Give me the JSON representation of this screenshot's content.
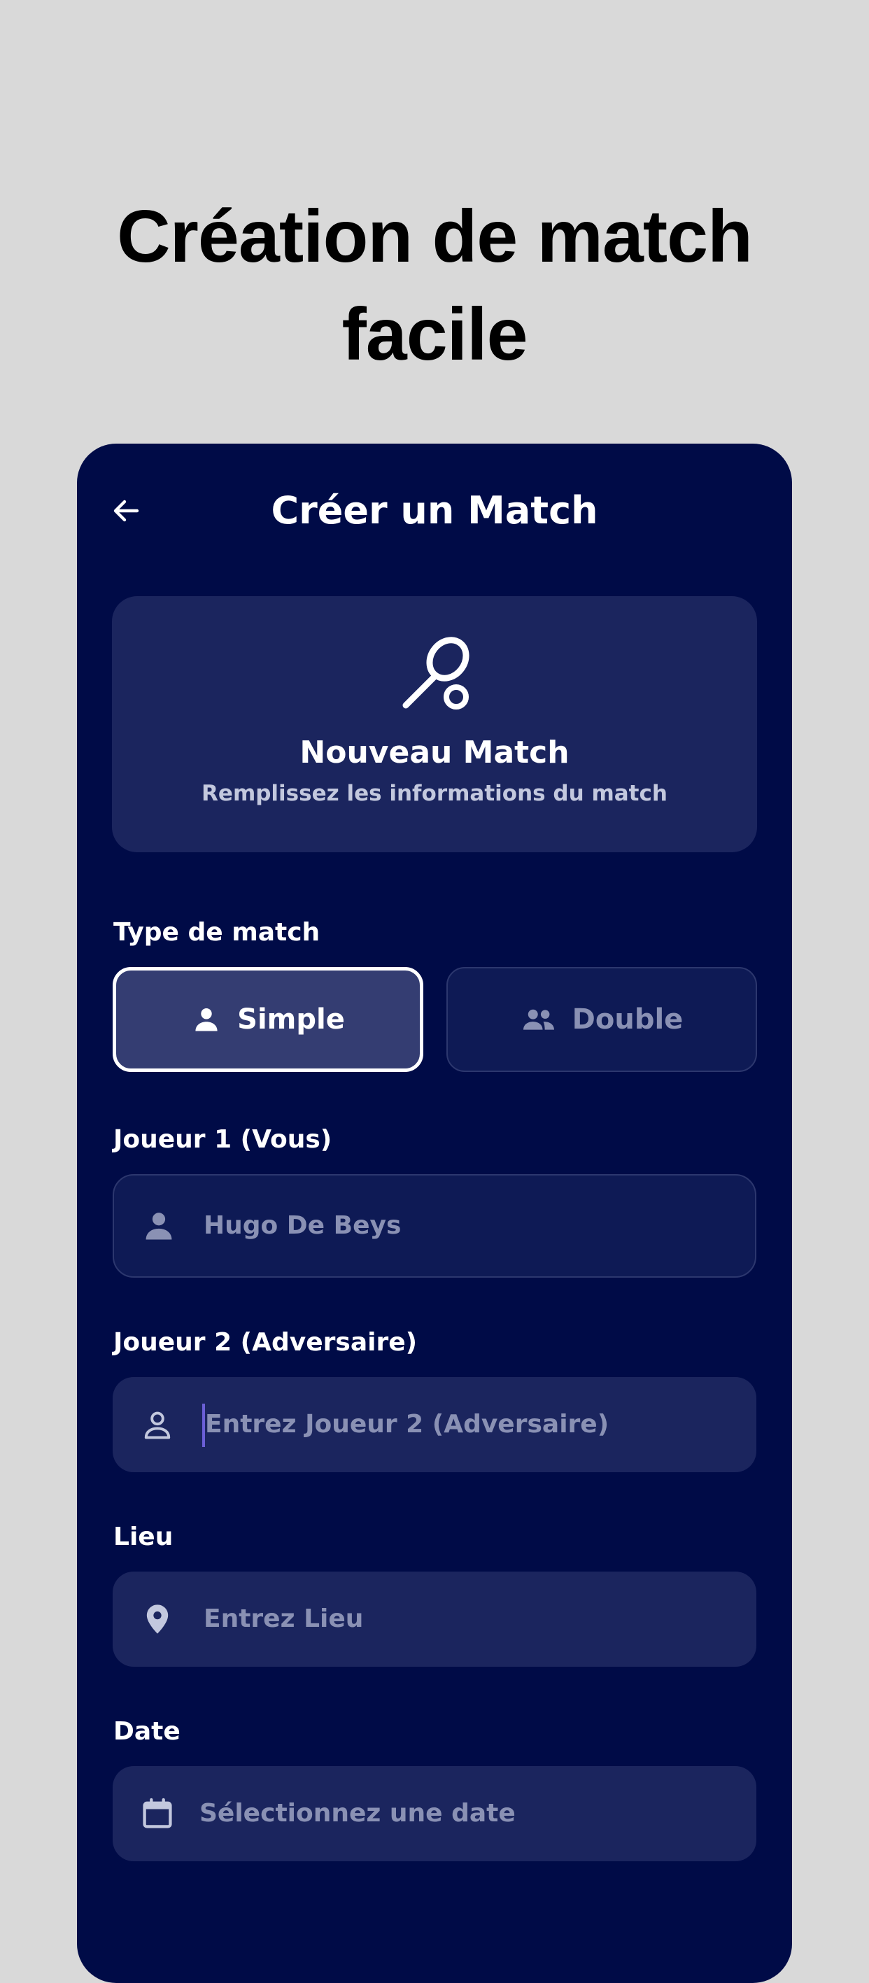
{
  "promo": {
    "title_line1": "Création de match",
    "title_line2": "facile"
  },
  "header": {
    "back_icon": "arrow-left-icon",
    "title": "Créer un Match"
  },
  "hero": {
    "icon": "tennis-racket-icon",
    "title": "Nouveau Match",
    "subtitle": "Remplissez les informations du match"
  },
  "match_type": {
    "label": "Type de match",
    "options": [
      {
        "label": "Simple",
        "icon": "person-icon",
        "selected": true
      },
      {
        "label": "Double",
        "icon": "people-icon",
        "selected": false
      }
    ]
  },
  "player1": {
    "label": "Joueur 1 (Vous)",
    "value": "Hugo De Beys",
    "icon": "person-icon"
  },
  "player2": {
    "label": "Joueur 2 (Adversaire)",
    "placeholder": "Entrez Joueur 2 (Adversaire)",
    "icon": "person-outline-icon"
  },
  "location": {
    "label": "Lieu",
    "placeholder": "Entrez Lieu",
    "icon": "location-pin-icon"
  },
  "date": {
    "label": "Date",
    "placeholder": "Sélectionnez une date",
    "icon": "calendar-icon"
  },
  "colors": {
    "page_background": "#d9d9d9",
    "app_background": "#000b47",
    "card_background": "#1b255e",
    "selected_option": "#343d72",
    "muted_text": "#8a91b4",
    "caret": "#6b5fd6"
  }
}
